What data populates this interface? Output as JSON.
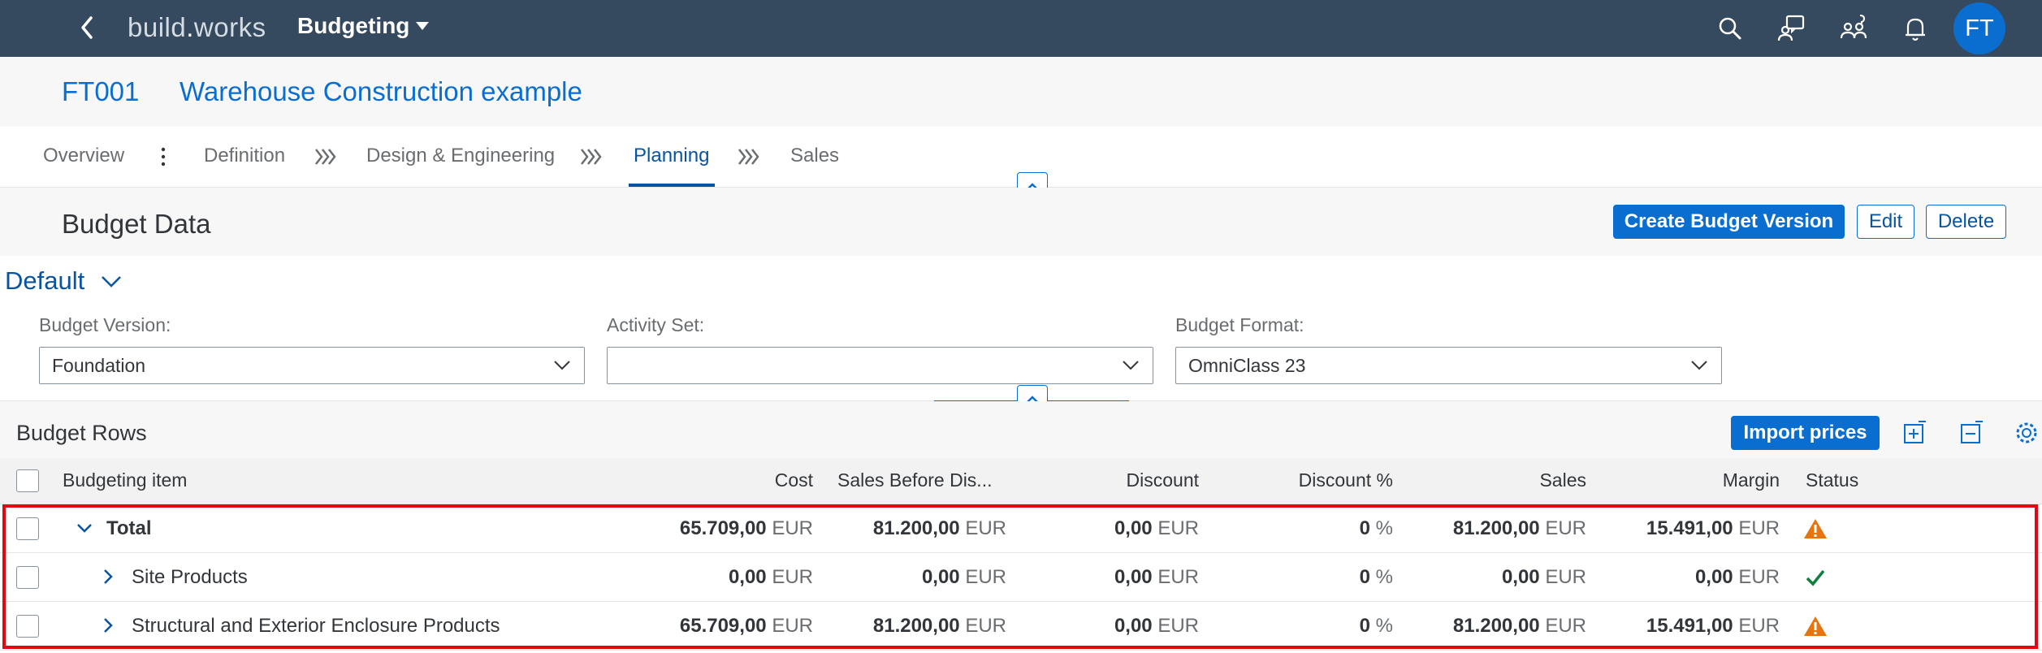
{
  "shell": {
    "logo_a": "build",
    "logo_dot": ".",
    "logo_b": "works",
    "title": "Budgeting",
    "avatar_initials": "FT",
    "icons": [
      "back-icon",
      "search-icon",
      "feedback-icon",
      "user-group-icon",
      "notifications-icon"
    ]
  },
  "object": {
    "id": "FT001",
    "title": "Warehouse Construction example"
  },
  "nav": {
    "tabs": [
      {
        "label": "Overview"
      },
      {
        "label": "Definition"
      },
      {
        "label": "Design & Engineering"
      },
      {
        "label": "Planning",
        "active": true
      },
      {
        "label": "Sales"
      }
    ]
  },
  "section": {
    "title": "Budget Data",
    "create_label": "Create Budget Version",
    "edit_label": "Edit",
    "delete_label": "Delete"
  },
  "filters": {
    "variant": "Default",
    "budget_version_label": "Budget Version:",
    "budget_version_value": "Foundation",
    "activity_set_label": "Activity Set:",
    "activity_set_value": "",
    "budget_format_label": "Budget Format:",
    "budget_format_value": "OmniClass 23"
  },
  "table": {
    "title": "Budget Rows",
    "import_label": "Import prices",
    "columns": {
      "item": "Budgeting item",
      "cost": "Cost",
      "sales_before": "Sales Before Dis...",
      "discount": "Discount",
      "discount_pct": "Discount %",
      "sales": "Sales",
      "margin": "Margin",
      "status": "Status"
    },
    "rows": [
      {
        "name": "Total",
        "cost": "65.709,00",
        "cost_unit": "EUR",
        "sales_before": "81.200,00",
        "sales_before_unit": "EUR",
        "discount": "0,00",
        "discount_unit": "EUR",
        "discount_pct": "0",
        "discount_pct_unit": "%",
        "sales": "81.200,00",
        "sales_unit": "EUR",
        "margin": "15.491,00",
        "margin_unit": "EUR",
        "status": "warning"
      },
      {
        "name": "Site Products",
        "cost": "0,00",
        "cost_unit": "EUR",
        "sales_before": "0,00",
        "sales_before_unit": "EUR",
        "discount": "0,00",
        "discount_unit": "EUR",
        "discount_pct": "0",
        "discount_pct_unit": "%",
        "sales": "0,00",
        "sales_unit": "EUR",
        "margin": "0,00",
        "margin_unit": "EUR",
        "status": "success"
      },
      {
        "name": "Structural and Exterior Enclosure Products",
        "cost": "65.709,00",
        "cost_unit": "EUR",
        "sales_before": "81.200,00",
        "sales_before_unit": "EUR",
        "discount": "0,00",
        "discount_unit": "EUR",
        "discount_pct": "0",
        "discount_pct_unit": "%",
        "sales": "81.200,00",
        "sales_unit": "EUR",
        "margin": "15.491,00",
        "margin_unit": "EUR",
        "status": "warning"
      }
    ]
  },
  "colors": {
    "shell": "#354a5f",
    "brand": "#0a6ed1",
    "warning": "#e9730c",
    "success": "#107e3e",
    "highlight": "#e30613"
  }
}
